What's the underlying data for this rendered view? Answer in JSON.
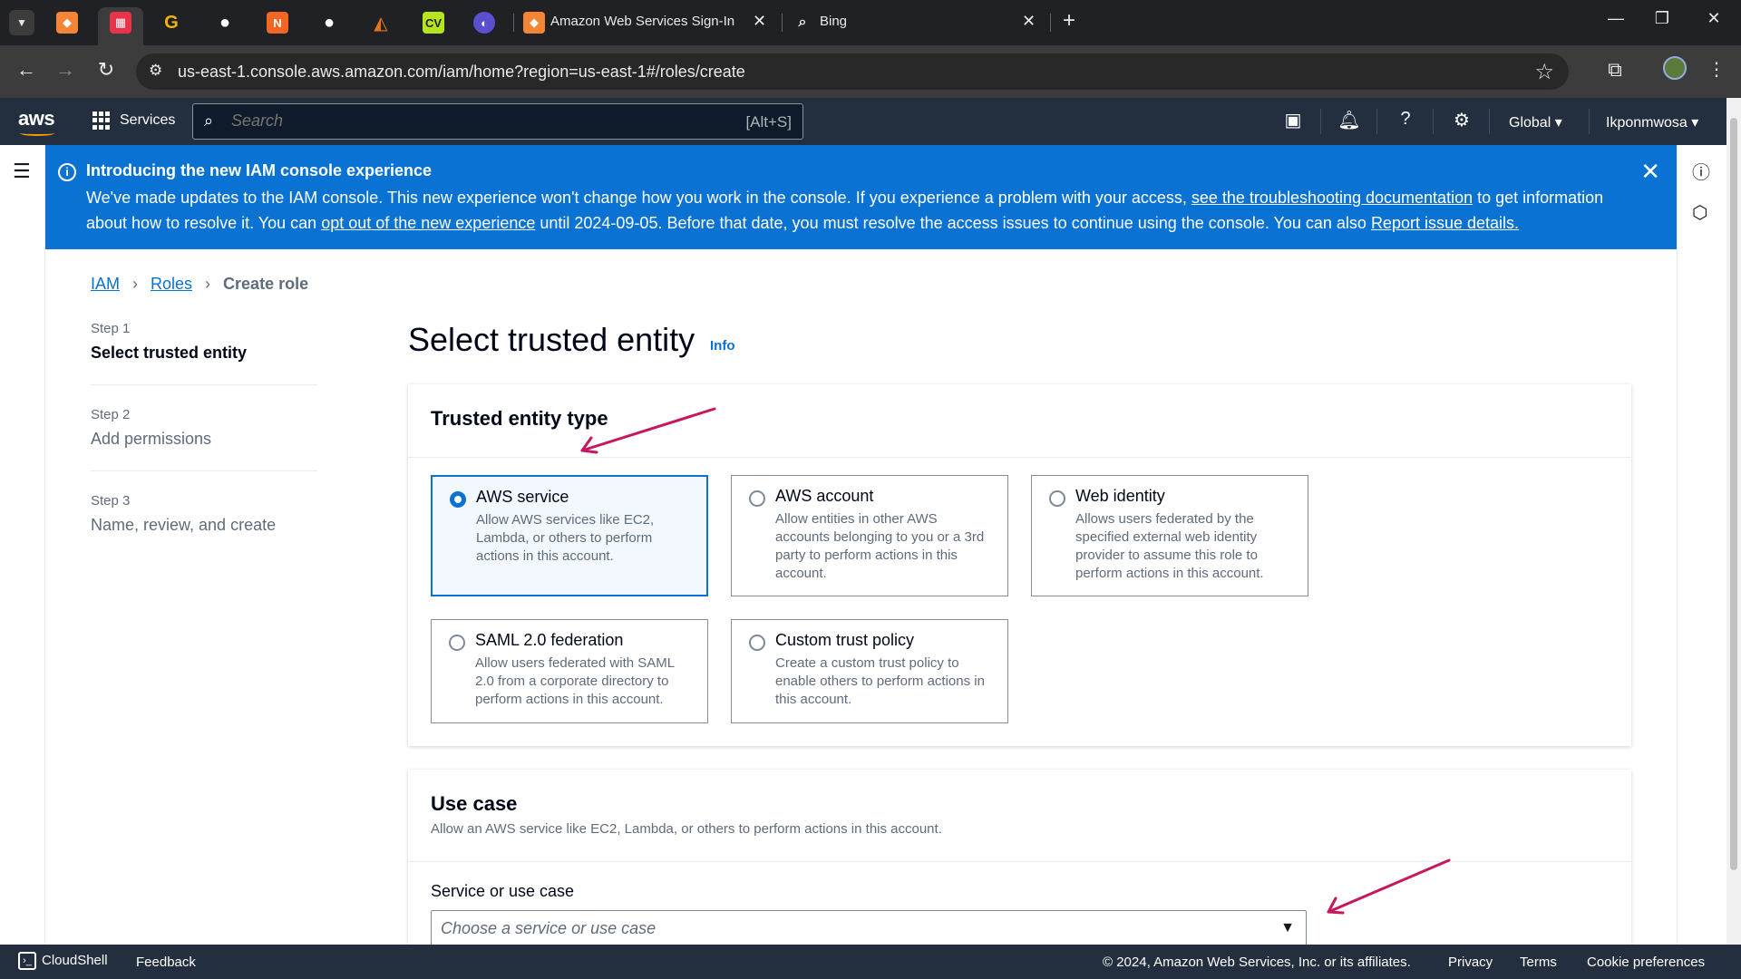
{
  "browser": {
    "tabs": [
      {
        "title": "Amazon Web Services Sign-In",
        "close": "✕"
      },
      {
        "title": "Bing",
        "close": "✕"
      }
    ],
    "new_tab": "+",
    "window_controls": {
      "minimize": "—",
      "restore": "❐",
      "close": "✕"
    },
    "url": "us-east-1.console.aws.amazon.com/iam/home?region=us-east-1#/roles/create",
    "icons": [
      "tab-search-icon",
      "aws-icon",
      "calendar-icon",
      "g-icon",
      "github-icon",
      "n-icon",
      "github-icon",
      "fox-icon",
      "cv-icon",
      "browser-icon"
    ]
  },
  "aws_header": {
    "logo": "aws",
    "services_label": "Services",
    "search_placeholder": "Search",
    "search_shortcut": "[Alt+S]",
    "region": "Global",
    "account": "Ikponmwosa"
  },
  "flash": {
    "title": "Introducing the new IAM console experience",
    "text1": "We've made updates to the IAM console. This new experience won't change how you work in the console. If you experience a problem with your access, ",
    "link1": "see the troubleshooting documentation",
    "text2": " to get information about how to resolve it. You can ",
    "link2": "opt out of the new experience",
    "text3": " until 2024-09-05. Before that date, you must resolve the access issues to continue using the console. You can also ",
    "link3": "Report issue details."
  },
  "breadcrumb": {
    "items": [
      {
        "label": "IAM"
      },
      {
        "label": "Roles"
      }
    ],
    "current": "Create role"
  },
  "steps": [
    {
      "num": "Step 1",
      "name": "Select trusted entity",
      "active": true
    },
    {
      "num": "Step 2",
      "name": "Add permissions",
      "active": false
    },
    {
      "num": "Step 3",
      "name": "Name, review, and create",
      "active": false
    }
  ],
  "page": {
    "title": "Select trusted entity",
    "info": "Info"
  },
  "trusted_entity": {
    "title": "Trusted entity type",
    "options": [
      {
        "label": "AWS service",
        "desc": "Allow AWS services like EC2, Lambda, or others to perform actions in this account.",
        "selected": true
      },
      {
        "label": "AWS account",
        "desc": "Allow entities in other AWS accounts belonging to you or a 3rd party to perform actions in this account.",
        "selected": false
      },
      {
        "label": "Web identity",
        "desc": "Allows users federated by the specified external web identity provider to assume this role to perform actions in this account.",
        "selected": false
      },
      {
        "label": "SAML 2.0 federation",
        "desc": "Allow users federated with SAML 2.0 from a corporate directory to perform actions in this account.",
        "selected": false
      },
      {
        "label": "Custom trust policy",
        "desc": "Create a custom trust policy to enable others to perform actions in this account.",
        "selected": false
      }
    ]
  },
  "use_case": {
    "title": "Use case",
    "desc": "Allow an AWS service like EC2, Lambda, or others to perform actions in this account.",
    "field_label": "Service or use case",
    "placeholder": "Choose a service or use case"
  },
  "footer": {
    "cloudshell": "CloudShell",
    "feedback": "Feedback",
    "copyright": "© 2024, Amazon Web Services, Inc. or its affiliates.",
    "privacy": "Privacy",
    "terms": "Terms",
    "cookies": "Cookie preferences"
  },
  "colors": {
    "aws_nav": "#232f3e",
    "flash_blue": "#0972d3",
    "link_blue": "#0972d3",
    "annotation_arrow": "#c7175f"
  }
}
